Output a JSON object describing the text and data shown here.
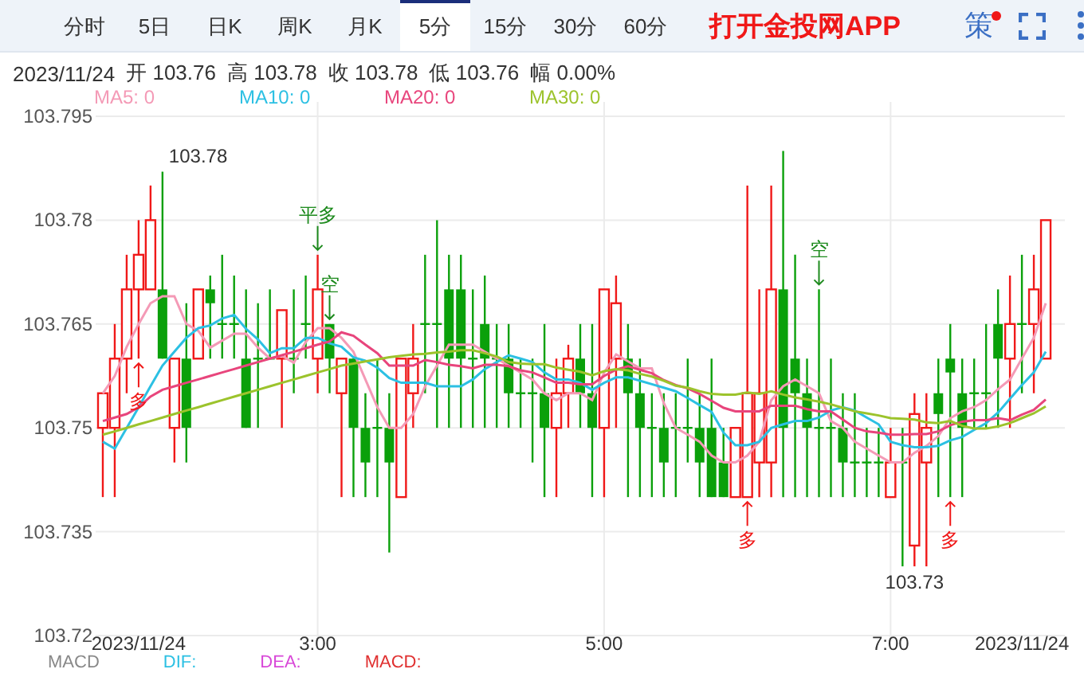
{
  "tabs": [
    {
      "label": "分时",
      "selected": false
    },
    {
      "label": "5日",
      "selected": false
    },
    {
      "label": "日K",
      "selected": false
    },
    {
      "label": "周K",
      "selected": false
    },
    {
      "label": "月K",
      "selected": false
    },
    {
      "label": "5分",
      "selected": true
    },
    {
      "label": "15分",
      "selected": false
    },
    {
      "label": "30分",
      "selected": false
    },
    {
      "label": "60分",
      "selected": false
    }
  ],
  "promo_link": "打开金投网APP",
  "strategy_button": {
    "label": "策",
    "notification": true
  },
  "quote": {
    "date": "2023/11/24",
    "fields": [
      {
        "label": "开",
        "value": "103.76"
      },
      {
        "label": "高",
        "value": "103.78"
      },
      {
        "label": "收",
        "value": "103.78"
      },
      {
        "label": "低",
        "value": "103.76"
      },
      {
        "label": "幅",
        "value": "0.00%"
      }
    ]
  },
  "chart": {
    "chart_data": {
      "type": "candlestick",
      "grid": true,
      "ylim": [
        103.72,
        103.795
      ],
      "yticks": [
        103.72,
        103.735,
        103.75,
        103.765,
        103.78,
        103.795
      ],
      "xlim": [
        87,
        493
      ],
      "xticks": [
        {
          "value": 105,
          "label": "2023/11/24"
        },
        {
          "value": 180,
          "label": "3:00"
        },
        {
          "value": 300,
          "label": "5:00"
        },
        {
          "value": 420,
          "label": "7:00"
        },
        {
          "value": 475,
          "label": "2023/11/24"
        }
      ],
      "x": [
        90,
        95,
        100,
        105,
        110,
        115,
        120,
        125,
        130,
        135,
        140,
        145,
        150,
        155,
        160,
        165,
        170,
        175,
        180,
        185,
        190,
        195,
        200,
        205,
        210,
        215,
        220,
        225,
        230,
        235,
        240,
        245,
        250,
        255,
        260,
        265,
        270,
        275,
        280,
        285,
        290,
        295,
        300,
        305,
        310,
        315,
        320,
        325,
        330,
        335,
        340,
        345,
        350,
        355,
        360,
        365,
        370,
        375,
        380,
        385,
        390,
        395,
        400,
        405,
        410,
        415,
        420,
        425,
        430,
        435,
        440,
        445,
        450,
        455,
        460,
        465,
        470,
        475,
        480,
        485
      ],
      "series": [
        {
          "name": "MA5: 0",
          "type": "line",
          "color": "#f49ab6",
          "values": [
            103.755,
            103.7575,
            103.7617,
            103.765,
            103.768,
            103.769,
            103.769,
            103.765,
            103.764,
            103.7616,
            103.7626,
            103.7636,
            103.7636,
            103.7616,
            103.76,
            103.7604,
            103.7594,
            103.7624,
            103.7644,
            103.7644,
            103.763,
            103.761,
            103.757,
            103.753,
            103.75,
            103.75,
            103.752,
            103.756,
            103.759,
            103.762,
            103.762,
            103.762,
            103.761,
            103.76,
            103.759,
            103.758,
            103.757,
            103.755,
            103.754,
            103.755,
            103.755,
            103.754,
            103.758,
            103.7606,
            103.7596,
            103.7586,
            103.7586,
            103.7536,
            103.75,
            103.749,
            103.748,
            103.746,
            103.745,
            103.745,
            103.746,
            103.748,
            103.754,
            103.756,
            103.757,
            103.756,
            103.755,
            103.751,
            103.75,
            103.748,
            103.747,
            103.746,
            103.745,
            103.745,
            103.7464,
            103.7474,
            103.7488,
            103.7514,
            103.7524,
            103.753,
            103.754,
            103.7556,
            103.757,
            103.76,
            103.763,
            103.768
          ]
        },
        {
          "name": "MA10: 0",
          "type": "line",
          "color": "#2cc0e3",
          "values": [
            103.748,
            103.747,
            103.75,
            103.753,
            103.756,
            103.759,
            103.761,
            103.763,
            103.7644,
            103.7648,
            103.7658,
            103.7663,
            103.7643,
            103.7628,
            103.7608,
            103.7615,
            103.7615,
            103.763,
            103.763,
            103.7622,
            103.7617,
            103.7602,
            103.7597,
            103.7587,
            103.7572,
            103.7565,
            103.7565,
            103.7565,
            103.756,
            103.756,
            103.756,
            103.757,
            103.7585,
            103.7595,
            103.7605,
            103.76,
            103.7595,
            103.758,
            103.757,
            103.757,
            103.7565,
            103.7555,
            103.7565,
            103.7573,
            103.7573,
            103.7568,
            103.7563,
            103.7558,
            103.7553,
            103.7543,
            103.7533,
            103.7523,
            103.7493,
            103.7475,
            103.7475,
            103.748,
            103.75,
            103.7505,
            103.751,
            103.751,
            103.7515,
            103.7525,
            103.753,
            103.7525,
            103.7515,
            103.7505,
            103.748,
            103.7475,
            103.7472,
            103.7472,
            103.7474,
            103.7482,
            103.7487,
            103.7497,
            103.7507,
            103.7522,
            103.7542,
            103.7562,
            103.758,
            103.761
          ]
        },
        {
          "name": "MA20: 0",
          "type": "line",
          "color": "#e8457c",
          "values": [
            103.751,
            103.7515,
            103.752,
            103.753,
            103.7545,
            103.7555,
            103.756,
            103.7565,
            103.757,
            103.7575,
            103.758,
            103.7585,
            103.759,
            103.7595,
            103.76,
            103.7605,
            103.761,
            103.7615,
            103.762,
            103.7625,
            103.7638,
            103.7633,
            103.762,
            103.7608,
            103.759,
            103.759,
            103.759,
            103.7598,
            103.7595,
            103.7591,
            103.7589,
            103.7586,
            103.7591,
            103.7591,
            103.7589,
            103.7583,
            103.758,
            103.7573,
            103.7565,
            103.7565,
            103.7563,
            103.7563,
            103.7575,
            103.7584,
            103.7589,
            103.7584,
            103.7579,
            103.7569,
            103.7562,
            103.7557,
            103.7549,
            103.7539,
            103.7529,
            103.7524,
            103.7524,
            103.7524,
            103.7532,
            103.7532,
            103.7532,
            103.7527,
            103.7524,
            103.7524,
            103.7512,
            103.75,
            103.7495,
            103.7493,
            103.749,
            103.749,
            103.7491,
            103.7491,
            103.7495,
            103.7504,
            103.7509,
            103.7511,
            103.7511,
            103.7514,
            103.7511,
            103.7519,
            103.7526,
            103.7541
          ]
        },
        {
          "name": "MA30: 0",
          "type": "line",
          "color": "#9cc32c",
          "values": [
            103.749,
            103.7495,
            103.75,
            103.7505,
            103.751,
            103.7515,
            103.752,
            103.7525,
            103.753,
            103.7535,
            103.754,
            103.7545,
            103.755,
            103.7555,
            103.756,
            103.7565,
            103.757,
            103.7575,
            103.758,
            103.7585,
            103.759,
            103.7593,
            103.7596,
            103.7599,
            103.7602,
            103.7604,
            103.7606,
            103.7607,
            103.7609,
            103.761,
            103.7612,
            103.7612,
            103.7608,
            103.7603,
            103.7595,
            103.7593,
            103.7592,
            103.7592,
            103.7587,
            103.7584,
            103.7581,
            103.7576,
            103.7582,
            103.7585,
            103.7583,
            103.7578,
            103.7574,
            103.7568,
            103.7561,
            103.7558,
            103.7553,
            103.7549,
            103.7548,
            103.7548,
            103.7551,
            103.7549,
            103.7553,
            103.7548,
            103.7544,
            103.7541,
            103.7538,
            103.7534,
            103.7529,
            103.7524,
            103.7521,
            103.7518,
            103.7514,
            103.7513,
            103.7512,
            103.7508,
            103.7507,
            103.751,
            103.7503,
            103.7499,
            103.7499,
            103.7502,
            103.7507,
            103.7514,
            103.7521,
            103.7531
          ]
        }
      ],
      "ohlc": [
        [
          103.75,
          103.755,
          103.74,
          103.755
        ],
        [
          103.75,
          103.765,
          103.74,
          103.76
        ],
        [
          103.76,
          103.775,
          103.755,
          103.77
        ],
        [
          103.77,
          103.78,
          103.76,
          103.775
        ],
        [
          103.77,
          103.785,
          103.77,
          103.78
        ],
        [
          103.77,
          103.787,
          103.76,
          103.76
        ],
        [
          103.75,
          103.76,
          103.745,
          103.76
        ],
        [
          103.76,
          103.768,
          103.745,
          103.75
        ],
        [
          103.76,
          103.77,
          103.76,
          103.77
        ],
        [
          103.77,
          103.772,
          103.76,
          103.768
        ],
        [
          103.765,
          103.775,
          103.76,
          103.765
        ],
        [
          103.765,
          103.772,
          103.76,
          103.765
        ],
        [
          103.76,
          103.77,
          103.75,
          103.75
        ],
        [
          103.76,
          103.768,
          103.75,
          103.76
        ],
        [
          103.76,
          103.77,
          103.76,
          103.76
        ],
        [
          103.76,
          103.767,
          103.75,
          103.767
        ],
        [
          103.76,
          103.77,
          103.755,
          103.76
        ],
        [
          103.765,
          103.772,
          103.76,
          103.765
        ],
        [
          103.76,
          103.775,
          103.755,
          103.77
        ],
        [
          103.765,
          103.765,
          103.755,
          103.76
        ],
        [
          103.755,
          103.76,
          103.74,
          103.76
        ],
        [
          103.76,
          103.76,
          103.74,
          103.75
        ],
        [
          103.75,
          103.755,
          103.74,
          103.745
        ],
        [
          103.75,
          103.76,
          103.74,
          103.75
        ],
        [
          103.75,
          103.755,
          103.732,
          103.745
        ],
        [
          103.74,
          103.76,
          103.74,
          103.76
        ],
        [
          103.755,
          103.765,
          103.75,
          103.76
        ],
        [
          103.765,
          103.775,
          103.755,
          103.765
        ],
        [
          103.765,
          103.78,
          103.75,
          103.765
        ],
        [
          103.77,
          103.775,
          103.75,
          103.76
        ],
        [
          103.77,
          103.775,
          103.75,
          103.76
        ],
        [
          103.76,
          103.77,
          103.75,
          103.76
        ],
        [
          103.765,
          103.772,
          103.75,
          103.76
        ],
        [
          103.76,
          103.765,
          103.75,
          103.76
        ],
        [
          103.76,
          103.765,
          103.75,
          103.755
        ],
        [
          103.755,
          103.76,
          103.75,
          103.755
        ],
        [
          103.755,
          103.76,
          103.745,
          103.755
        ],
        [
          103.755,
          103.765,
          103.74,
          103.75
        ],
        [
          103.75,
          103.76,
          103.74,
          103.755
        ],
        [
          103.755,
          103.762,
          103.75,
          103.76
        ],
        [
          103.76,
          103.765,
          103.75,
          103.755
        ],
        [
          103.755,
          103.765,
          103.74,
          103.75
        ],
        [
          103.75,
          103.77,
          103.74,
          103.77
        ],
        [
          103.76,
          103.772,
          103.75,
          103.768
        ],
        [
          103.76,
          103.765,
          103.74,
          103.755
        ],
        [
          103.755,
          103.76,
          103.74,
          103.75
        ],
        [
          103.75,
          103.755,
          103.74,
          103.75
        ],
        [
          103.75,
          103.755,
          103.74,
          103.745
        ],
        [
          103.75,
          103.755,
          103.74,
          103.75
        ],
        [
          103.75,
          103.76,
          103.745,
          103.75
        ],
        [
          103.75,
          103.755,
          103.74,
          103.745
        ],
        [
          103.75,
          103.76,
          103.74,
          103.74
        ],
        [
          103.745,
          103.75,
          103.74,
          103.74
        ],
        [
          103.74,
          103.75,
          103.74,
          103.75
        ],
        [
          103.74,
          103.785,
          103.74,
          103.755
        ],
        [
          103.745,
          103.77,
          103.74,
          103.755
        ],
        [
          103.745,
          103.785,
          103.74,
          103.77
        ],
        [
          103.77,
          103.79,
          103.74,
          103.75
        ],
        [
          103.76,
          103.775,
          103.74,
          103.755
        ],
        [
          103.755,
          103.76,
          103.74,
          103.75
        ],
        [
          103.75,
          103.77,
          103.74,
          103.75
        ],
        [
          103.75,
          103.76,
          103.74,
          103.75
        ],
        [
          103.75,
          103.755,
          103.74,
          103.745
        ],
        [
          103.745,
          103.755,
          103.74,
          103.745
        ],
        [
          103.745,
          103.75,
          103.74,
          103.745
        ],
        [
          103.745,
          103.75,
          103.74,
          103.745
        ],
        [
          103.74,
          103.75,
          103.74,
          103.745
        ],
        [
          103.745,
          103.75,
          103.73,
          103.745
        ],
        [
          103.733,
          103.755,
          103.73,
          103.752
        ],
        [
          103.745,
          103.755,
          103.73,
          103.75
        ],
        [
          103.755,
          103.76,
          103.74,
          103.752
        ],
        [
          103.76,
          103.765,
          103.74,
          103.758
        ],
        [
          103.755,
          103.76,
          103.74,
          103.75
        ],
        [
          103.755,
          103.76,
          103.75,
          103.755
        ],
        [
          103.755,
          103.765,
          103.75,
          103.755
        ],
        [
          103.765,
          103.77,
          103.75,
          103.76
        ],
        [
          103.76,
          103.772,
          103.75,
          103.765
        ],
        [
          103.765,
          103.775,
          103.755,
          103.765
        ],
        [
          103.765,
          103.775,
          103.755,
          103.77
        ],
        [
          103.76,
          103.78,
          103.76,
          103.78
        ]
      ],
      "annotations": [
        "103.78",
        "103.73",
        "平多",
        "空",
        "空",
        "多",
        "多",
        "多"
      ]
    }
  },
  "indicator_legend": [
    {
      "label": "MACD",
      "color": "#888888"
    },
    {
      "label": "DIF:",
      "color": "#2cc0e3"
    },
    {
      "label": "DEA:",
      "color": "#d848d8"
    },
    {
      "label": "MACD:",
      "color": "#e03030"
    }
  ]
}
